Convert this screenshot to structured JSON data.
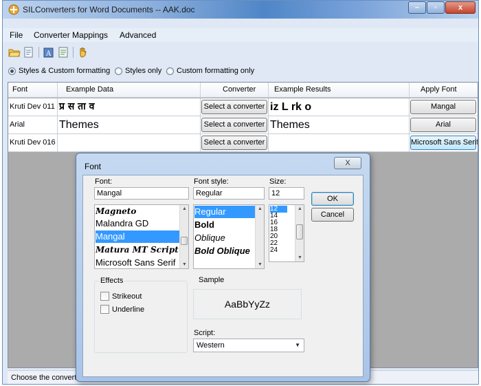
{
  "window": {
    "title": "SILConverters for Word Documents -- AAK.doc",
    "controls": [
      "–",
      "▫",
      "x"
    ]
  },
  "menu": [
    "File",
    "Converter Mappings",
    "Advanced"
  ],
  "toolbar_icons": [
    "open-folder-icon",
    "save-document-icon",
    "font-icon",
    "properties-icon",
    "hand-icon"
  ],
  "options": {
    "radio": [
      "Styles & Custom formatting",
      "Styles only",
      "Custom formatting only"
    ],
    "selected_index": 0
  },
  "grid": {
    "columns": [
      "Font",
      "Example Data",
      "Converter",
      "Example Results",
      "Apply Font"
    ],
    "rows": [
      {
        "font": "Kruti Dev 011",
        "example_data": "प्र स ता व",
        "converter": "Select a converter",
        "example_results": "iz L rk o",
        "apply_font": "Mangal"
      },
      {
        "font": "Arial",
        "example_data": "Themes",
        "converter": "Select a converter",
        "example_results": "Themes",
        "apply_font": "Arial"
      },
      {
        "font": "Kruti Dev 016",
        "example_data": "",
        "converter": "Select a converter",
        "example_results": "",
        "apply_font": "Microsoft Sans Serif"
      }
    ]
  },
  "status": {
    "text": "Choose the converter"
  },
  "font_dialog": {
    "title": "Font",
    "close_label": "X",
    "font_label": "Font:",
    "font_value": "Mangal",
    "fonts": [
      "Magneto",
      "Malandra GD",
      "Mangal",
      "Matura MT Script",
      "Microsoft Sans Serif"
    ],
    "font_selected_index": 2,
    "style_label": "Font style:",
    "style_value": "Regular",
    "styles": [
      "Regular",
      "Bold",
      "Oblique",
      "Bold Oblique"
    ],
    "style_selected_index": 0,
    "size_label": "Size:",
    "size_value": "12",
    "sizes": [
      "12",
      "14",
      "16",
      "18",
      "20",
      "22",
      "24"
    ],
    "size_selected_index": 0,
    "ok_label": "OK",
    "cancel_label": "Cancel",
    "effects_label": "Effects",
    "strikeout_label": "Strikeout",
    "underline_label": "Underline",
    "sample_label": "Sample",
    "sample_text": "AaBbYyZz",
    "script_label": "Script:",
    "script_value": "Western"
  }
}
